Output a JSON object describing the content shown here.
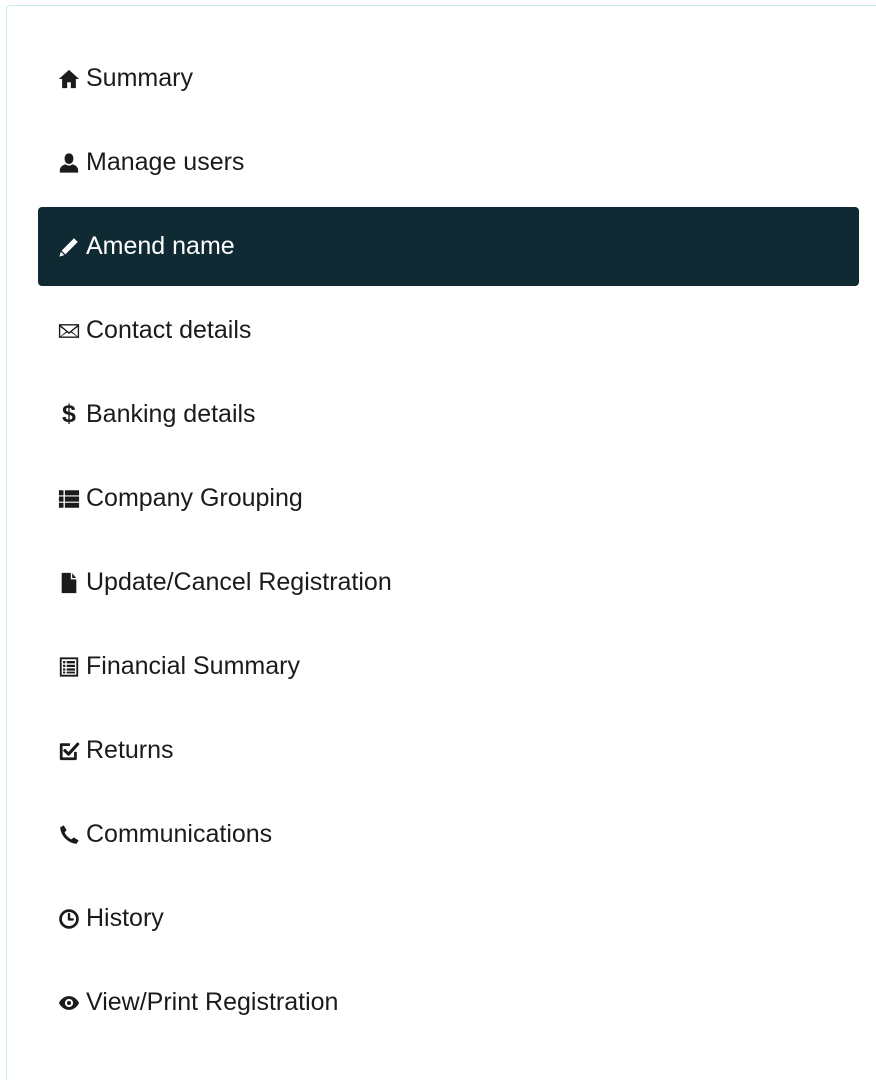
{
  "nav": {
    "active_index": 2,
    "items": [
      {
        "label": "Summary",
        "icon": "home-icon"
      },
      {
        "label": "Manage users",
        "icon": "user-icon"
      },
      {
        "label": "Amend name",
        "icon": "pencil-icon"
      },
      {
        "label": "Contact details",
        "icon": "envelope-icon"
      },
      {
        "label": "Banking details",
        "icon": "dollar-icon"
      },
      {
        "label": "Company Grouping",
        "icon": "list-icon"
      },
      {
        "label": "Update/Cancel Registration",
        "icon": "file-icon"
      },
      {
        "label": "Financial Summary",
        "icon": "list-alt-icon"
      },
      {
        "label": "Returns",
        "icon": "check-square-icon"
      },
      {
        "label": "Communications",
        "icon": "phone-icon"
      },
      {
        "label": "History",
        "icon": "clock-icon"
      },
      {
        "label": "View/Print Registration",
        "icon": "eye-icon"
      }
    ]
  },
  "colors": {
    "active_background": "#0f2a33",
    "active_text": "#ffffff",
    "text": "#1b1b1b",
    "panel_border": "#c8e9f1"
  }
}
